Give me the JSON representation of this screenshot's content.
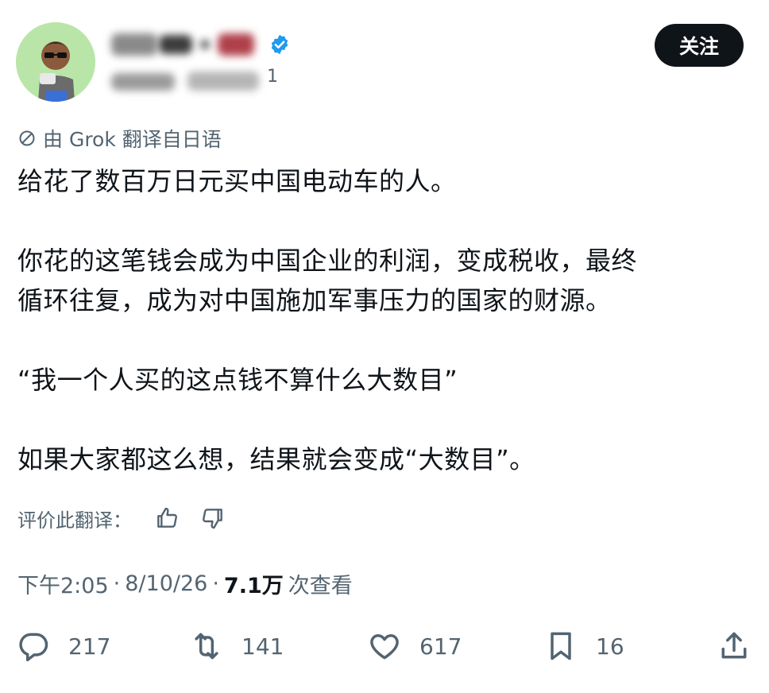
{
  "header": {
    "follow_label": "关注",
    "handle_tail": "1"
  },
  "translation": {
    "note": "由 Grok 翻译自日语"
  },
  "tweet": {
    "paragraphs": [
      "给花了数百万日元买中国电动车的人。",
      "你花的这笔钱会成为中国企业的利润，变成税收，最终\n循环往复，成为对中国施加军事压力的国家的财源。",
      "“我一个人买的这点钱不算什么大数目”",
      "如果大家都这么想，结果就会变成“大数目”。"
    ]
  },
  "rate": {
    "label": "评价此翻译："
  },
  "meta": {
    "time": "下午2:05",
    "date": "8/10/26",
    "views": "7.1万",
    "views_suffix": "次查看"
  },
  "actions": {
    "replies": "217",
    "retweets": "141",
    "likes": "617",
    "bookmarks": "16"
  },
  "colors": {
    "text": "#0f1419",
    "muted": "#536471",
    "verified": "#1d9bf0",
    "follow_bg": "#0f1419"
  },
  "icons": [
    "avatar",
    "verified-badge-icon",
    "translate-icon",
    "thumbs-up-icon",
    "thumbs-down-icon",
    "reply-icon",
    "retweet-icon",
    "like-icon",
    "bookmark-icon",
    "share-icon"
  ]
}
